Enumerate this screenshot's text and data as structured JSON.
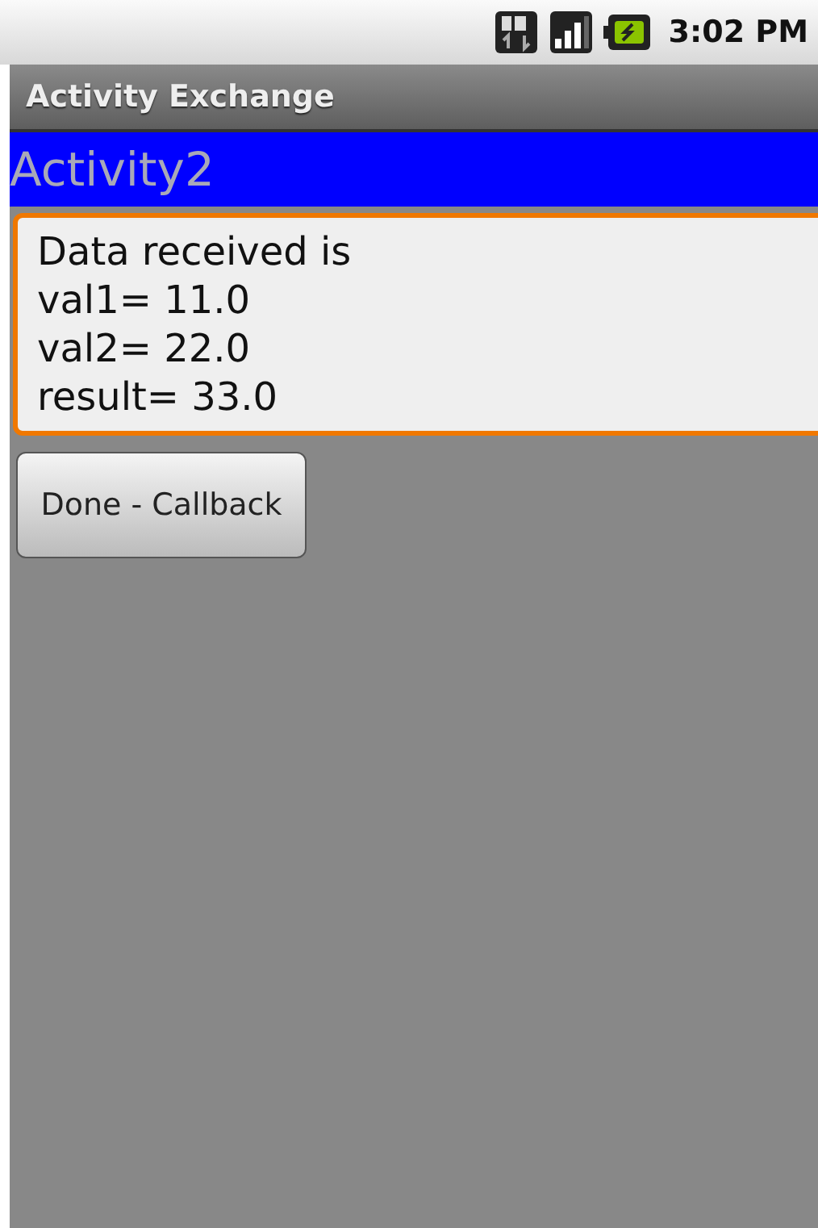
{
  "status_bar": {
    "time": "3:02 PM"
  },
  "title_bar": {
    "title": "Activity Exchange"
  },
  "header": {
    "text": "Activity2"
  },
  "text_field": {
    "focused": true,
    "lines": [
      "Data received is",
      "val1= 11.0",
      "val2= 22.0",
      "result= 33.0"
    ]
  },
  "buttons": [
    "Done - Callback"
  ]
}
